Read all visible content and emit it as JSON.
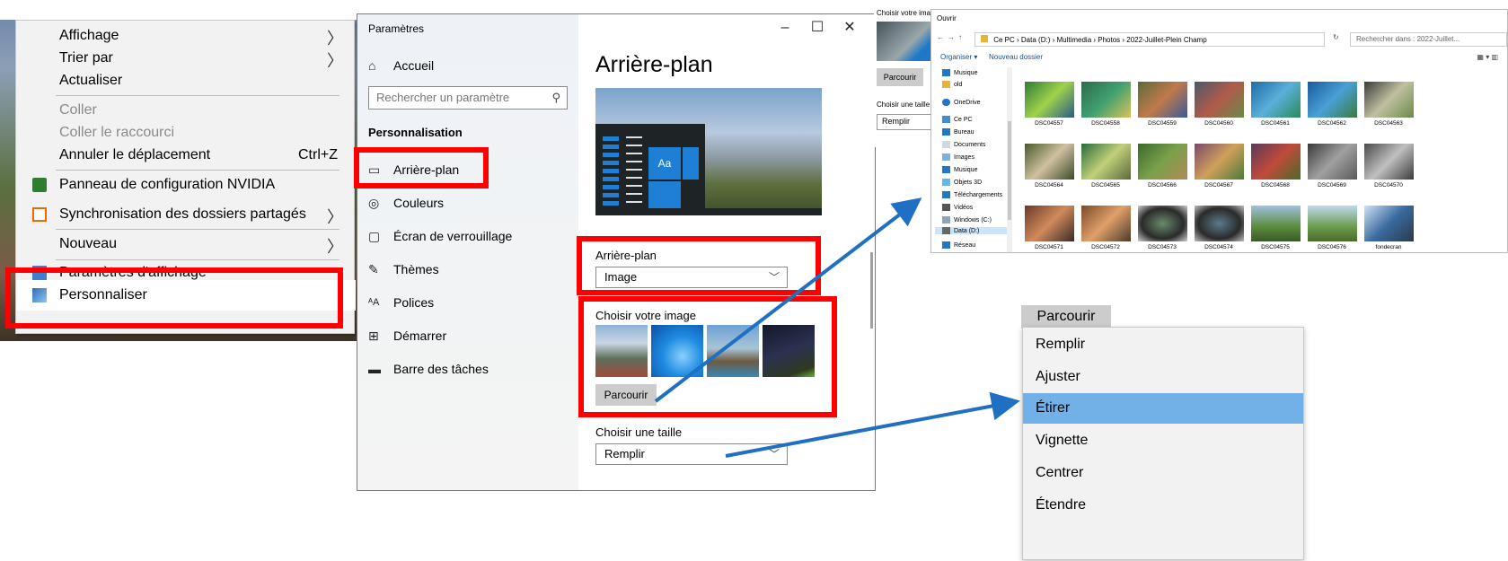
{
  "context_menu": {
    "items": [
      {
        "label": "Affichage",
        "submenu": true,
        "disabled": false
      },
      {
        "label": "Trier par",
        "submenu": true,
        "disabled": false
      },
      {
        "label": "Actualiser",
        "submenu": false,
        "disabled": false
      },
      {
        "label": "Coller",
        "submenu": false,
        "disabled": true
      },
      {
        "label": "Coller le raccourci",
        "submenu": false,
        "disabled": true
      },
      {
        "label": "Annuler le déplacement",
        "shortcut": "Ctrl+Z",
        "submenu": false,
        "disabled": false
      },
      {
        "label": "Panneau de configuration NVIDIA",
        "icon": "nvidia-icon",
        "submenu": false,
        "disabled": false
      },
      {
        "label": "Synchronisation des dossiers partagés",
        "icon": "sync-folder-icon",
        "submenu": true,
        "disabled": false
      },
      {
        "label": "Nouveau",
        "submenu": true,
        "disabled": false
      },
      {
        "label": "Paramètres d'affichage",
        "icon": "display-icon",
        "submenu": false,
        "disabled": false
      },
      {
        "label": "Personnaliser",
        "icon": "personalize-icon",
        "submenu": false,
        "disabled": false
      }
    ]
  },
  "settings": {
    "window_title": "Paramètres",
    "window_controls": [
      "–",
      "☐",
      "✕"
    ],
    "home_label": "Accueil",
    "search_placeholder": "Rechercher un paramètre",
    "section_label": "Personnalisation",
    "nav": [
      {
        "label": "Arrière-plan",
        "icon": "picture-icon",
        "active": true
      },
      {
        "label": "Couleurs",
        "icon": "palette-icon",
        "active": false
      },
      {
        "label": "Écran de verrouillage",
        "icon": "lockscreen-icon",
        "active": false
      },
      {
        "label": "Thèmes",
        "icon": "brush-icon",
        "active": false
      },
      {
        "label": "Polices",
        "icon": "font-icon",
        "active": false
      },
      {
        "label": "Démarrer",
        "icon": "start-icon",
        "active": false
      },
      {
        "label": "Barre des tâches",
        "icon": "taskbar-icon",
        "active": false
      }
    ],
    "page_title": "Arrière-plan",
    "preview_tile_text": "Aa",
    "background_label": "Arrière-plan",
    "background_value": "Image",
    "choose_image_label": "Choisir votre image",
    "browse_label": "Parcourir",
    "choose_size_label": "Choisir une taille",
    "size_value": "Remplir"
  },
  "mini_window": {
    "title": "Choisir votre ima",
    "browse_label": "Parcourir",
    "size_label": "Choisir une taille",
    "size_value": "Remplir"
  },
  "explorer": {
    "title": "Ouvrir",
    "path": [
      "Ce PC",
      "Data (D:)",
      "Multimedia",
      "Photos",
      "2022-Juillet-Plein Champ"
    ],
    "search_placeholder": "Rechercher dans : 2022-Juillet...",
    "toolbar": {
      "organize": "Organiser ▾",
      "new_folder": "Nouveau dossier"
    },
    "tree": [
      "Musique",
      "old",
      "OneDrive",
      "Ce PC",
      "Bureau",
      "Documents",
      "Images",
      "Musique",
      "Objets 3D",
      "Téléchargements",
      "Vidéos",
      "Windows (C:)",
      "Data (D:)",
      "Réseau"
    ],
    "files": [
      "DSC04557",
      "DSC04558",
      "DSC04559",
      "DSC04560",
      "DSC04561",
      "DSC04562",
      "DSC04563",
      "DSC04564",
      "DSC04565",
      "DSC04566",
      "DSC04567",
      "DSC04568",
      "DSC04569",
      "DSC04570",
      "DSC04571",
      "DSC04572",
      "DSC04573",
      "DSC04574",
      "DSC04575",
      "DSC04576",
      "fondecran"
    ]
  },
  "size_dropdown": {
    "browse_label": "Parcourir",
    "options": [
      {
        "label": "Remplir",
        "selected": false
      },
      {
        "label": "Ajuster",
        "selected": false
      },
      {
        "label": "Étirer",
        "selected": true
      },
      {
        "label": "Vignette",
        "selected": false
      },
      {
        "label": "Centrer",
        "selected": false
      },
      {
        "label": "Étendre",
        "selected": false
      }
    ]
  },
  "colors": {
    "highlight_red": "#ff0000",
    "arrow_blue": "#1f6fc2",
    "selected_option": "#72b0e8",
    "accent_tile": "#1f7fd4"
  }
}
